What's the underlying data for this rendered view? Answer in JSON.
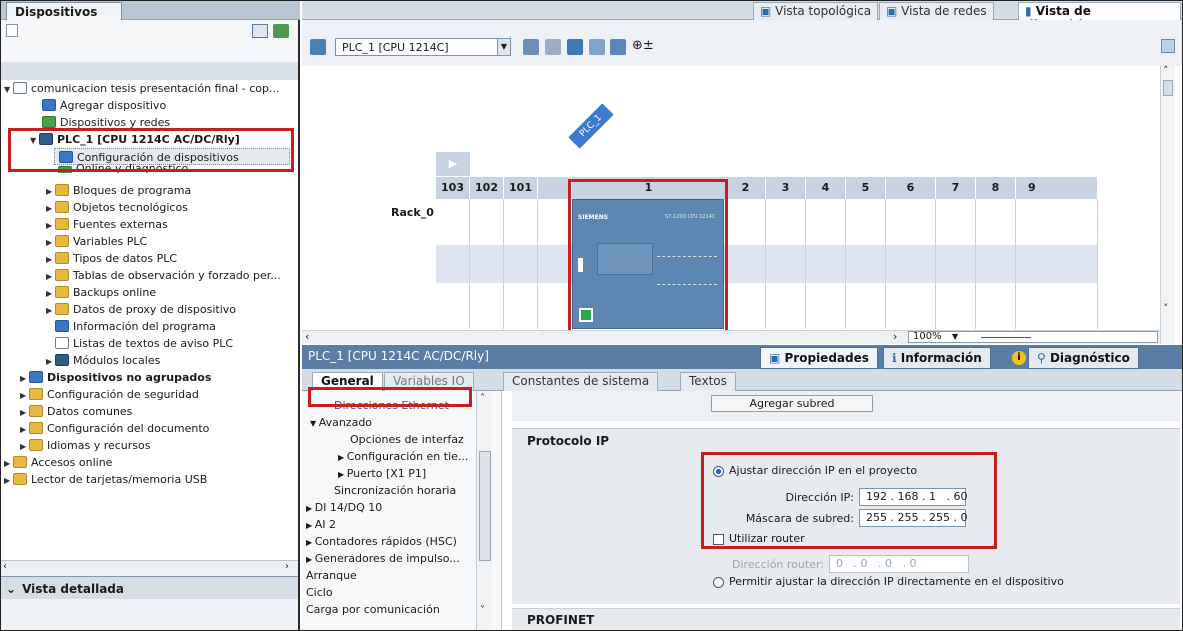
{
  "left_panel": {
    "tab": "Dispositivos",
    "tree": [
      {
        "label": "comunicacion tesis presentación final - cop..."
      },
      {
        "label": "Agregar dispositivo"
      },
      {
        "label": "Dispositivos y redes"
      },
      {
        "label": "PLC_1 [CPU 1214C AC/DC/Rly]"
      },
      {
        "label": "Configuración de dispositivos"
      },
      {
        "label": "Online y diagnóstico"
      },
      {
        "label": "Bloques de programa"
      },
      {
        "label": "Objetos tecnológicos"
      },
      {
        "label": "Fuentes externas"
      },
      {
        "label": "Variables PLC"
      },
      {
        "label": "Tipos de datos PLC"
      },
      {
        "label": "Tablas de observación y forzado per..."
      },
      {
        "label": "Backups online"
      },
      {
        "label": "Datos de proxy de dispositivo"
      },
      {
        "label": "Información del programa"
      },
      {
        "label": "Listas de textos de aviso PLC"
      },
      {
        "label": "Módulos locales"
      },
      {
        "label": "Dispositivos no agrupados"
      },
      {
        "label": "Configuración de seguridad"
      },
      {
        "label": "Datos comunes"
      },
      {
        "label": "Configuración del documento"
      },
      {
        "label": "Idiomas y recursos"
      },
      {
        "label": "Accesos online"
      },
      {
        "label": "Lector de tarjetas/memoria USB"
      }
    ],
    "detail_view": "Vista detallada"
  },
  "view_tabs": {
    "topology": "Vista topológica",
    "network": "Vista de redes",
    "device": "Vista de dispositivos"
  },
  "toolbar": {
    "device_select": "PLC_1 [CPU 1214C]"
  },
  "rack": {
    "name": "Rack_0",
    "plc_label": "PLC_1",
    "slots": [
      "103",
      "102",
      "101",
      "1",
      "2",
      "3",
      "4",
      "5",
      "6",
      "7",
      "8",
      "9"
    ],
    "brand": "SIEMENS",
    "model": "S7-1200 CPU 1214C"
  },
  "zoom": "100%",
  "properties": {
    "title": "PLC_1 [CPU 1214C AC/DC/Rly]",
    "tabs": {
      "props": "Propiedades",
      "info": "Información",
      "diag": "Diagnóstico"
    },
    "subtabs": [
      "General",
      "Variables IO",
      "Constantes de sistema",
      "Textos"
    ],
    "nav": [
      "Direcciones Ethernet",
      "Avanzado",
      "Opciones de interfaz",
      "Configuración en tie...",
      "Puerto [X1 P1]",
      "Sincronización horaria",
      "DI 14/DQ 10",
      "AI 2",
      "Contadores rápidos (HSC)",
      "Generadores de impulso...",
      "Arranque",
      "Ciclo",
      "Carga por comunicación"
    ],
    "add_subnet": "Agregar subred",
    "ip_section": "Protocolo IP",
    "set_ip_project": "Ajustar dirección IP en el proyecto",
    "ip_label": "Dirección IP:",
    "ip_value": "192 . 168 . 1   . 60",
    "mask_label": "Máscara de subred:",
    "mask_value": "255 . 255 . 255 . 0",
    "use_router": "Utilizar router",
    "router_label": "Dirección router:",
    "router_value": "0   . 0   . 0   . 0",
    "allow_direct": "Permitir ajustar la dirección IP directamente en el dispositivo",
    "profinet": "PROFINET"
  },
  "colors": {
    "highlight": "#c81e1e",
    "accent": "#5a7da5"
  }
}
